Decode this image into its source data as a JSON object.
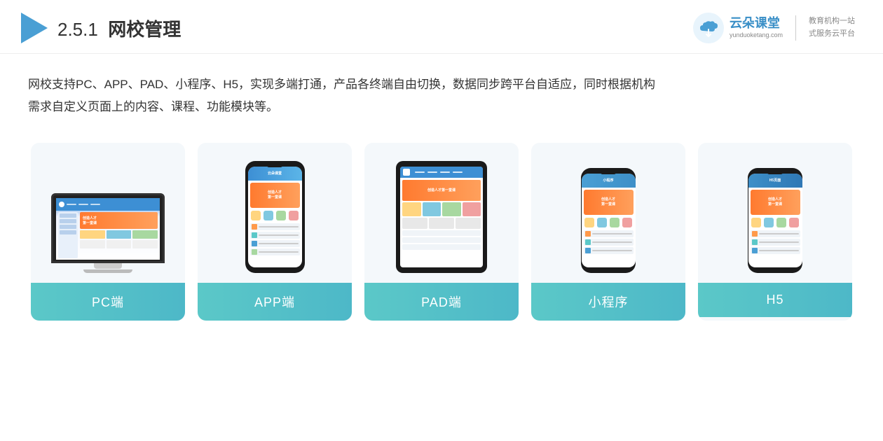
{
  "header": {
    "section_number": "2.5.1",
    "title_plain": "网校管理",
    "brand_name": "云朵课堂",
    "brand_domain": "yunduoketang.com",
    "brand_slogan_line1": "教育机构一站",
    "brand_slogan_line2": "式服务云平台"
  },
  "description": {
    "text": "网校支持PC、APP、PAD、小程序、H5，实现多端打通，产品各终端自由切换，数据同步跨平台自适应，同时根据机构需求自定义页面上的内容、课程、功能模块等。"
  },
  "cards": [
    {
      "id": "pc",
      "label": "PC端",
      "type": "desktop"
    },
    {
      "id": "app",
      "label": "APP端",
      "type": "phone"
    },
    {
      "id": "pad",
      "label": "PAD端",
      "type": "tablet"
    },
    {
      "id": "miniapp",
      "label": "小程序",
      "type": "phone"
    },
    {
      "id": "h5",
      "label": "H5",
      "type": "phone"
    }
  ],
  "colors": {
    "card_bg": "#f4f8fb",
    "card_label_bg_start": "#5bc8c8",
    "card_label_bg_end": "#4db8c8",
    "monitor_border": "#333333",
    "phone_body": "#1a1a1a",
    "header_accent": "#4a9fd4",
    "text_primary": "#333333",
    "banner_start": "#ff7a2f",
    "banner_end": "#ffa05c"
  }
}
